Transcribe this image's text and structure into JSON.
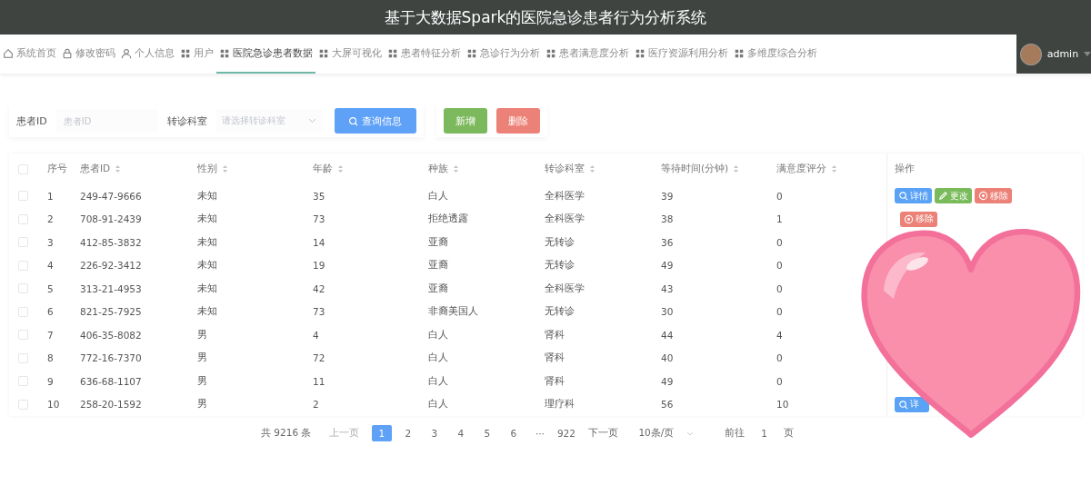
{
  "window": {
    "title": "基于大数据Spark的医院急诊患者行为分析系统"
  },
  "nav": {
    "items": [
      {
        "label": "系统首页",
        "kind": "home",
        "selected": false
      },
      {
        "label": "修改密码",
        "kind": "lock",
        "selected": false
      },
      {
        "label": "个人信息",
        "kind": "person",
        "selected": false
      },
      {
        "label": "用户",
        "kind": "grid",
        "selected": false
      },
      {
        "label": "医院急诊患者数据",
        "kind": "grid",
        "selected": true
      },
      {
        "label": "大屏可视化",
        "kind": "grid",
        "selected": false
      },
      {
        "label": "患者特征分析",
        "kind": "grid",
        "selected": false
      },
      {
        "label": "急诊行为分析",
        "kind": "grid",
        "selected": false
      },
      {
        "label": "患者满意度分析",
        "kind": "grid",
        "selected": false
      },
      {
        "label": "医疗资源利用分析",
        "kind": "grid",
        "selected": false
      },
      {
        "label": "多维度综合分析",
        "kind": "grid",
        "selected": false
      }
    ],
    "user": "admin"
  },
  "search": {
    "fields": [
      {
        "label": "患者ID",
        "placeholder": "患者ID",
        "kind": "input"
      },
      {
        "label": "转诊科室",
        "placeholder": "请选择转诊科室",
        "kind": "select"
      }
    ],
    "query_button": "查询信息"
  },
  "toolbar": [
    {
      "label": "新增",
      "kind": "add"
    },
    {
      "label": "删除",
      "kind": "delete"
    }
  ],
  "table": {
    "select_all": {
      "checked": false
    },
    "columns": [
      {
        "label": "序号",
        "sortable": false
      },
      {
        "label": "患者ID",
        "sortable": true
      },
      {
        "label": "性别",
        "sortable": true
      },
      {
        "label": "年龄",
        "sortable": true
      },
      {
        "label": "种族",
        "sortable": true
      },
      {
        "label": "转诊科室",
        "sortable": true
      },
      {
        "label": "等待时间(分钟)",
        "sortable": true
      },
      {
        "label": "满意度评分",
        "sortable": true
      },
      {
        "label": "操作",
        "sortable": false
      }
    ],
    "rows": [
      {
        "checked": false,
        "cells": [
          "1",
          "249-47-9666",
          "未知",
          "35",
          "白人",
          "全科医学",
          "39",
          "0"
        ],
        "actions": [
          {
            "kind": "detail",
            "label": "详情"
          },
          {
            "kind": "edit",
            "label": "更改"
          },
          {
            "kind": "remove",
            "label": "移除"
          }
        ]
      },
      {
        "checked": false,
        "cells": [
          "2",
          "708-91-2439",
          "未知",
          "73",
          "拒绝透露",
          "全科医学",
          "38",
          "1"
        ],
        "actions": [
          {
            "kind": "remove",
            "label": "移除"
          }
        ]
      },
      {
        "checked": false,
        "cells": [
          "3",
          "412-85-3832",
          "未知",
          "14",
          "亚裔",
          "无转诊",
          "36",
          "0"
        ],
        "actions": []
      },
      {
        "checked": false,
        "cells": [
          "4",
          "226-92-3412",
          "未知",
          "19",
          "亚裔",
          "无转诊",
          "49",
          "0"
        ],
        "actions": []
      },
      {
        "checked": false,
        "cells": [
          "5",
          "313-21-4953",
          "未知",
          "42",
          "亚裔",
          "全科医学",
          "43",
          "0"
        ],
        "actions": []
      },
      {
        "checked": false,
        "cells": [
          "6",
          "821-25-7925",
          "未知",
          "73",
          "非裔美国人",
          "无转诊",
          "30",
          "0"
        ],
        "actions": []
      },
      {
        "checked": false,
        "cells": [
          "7",
          "406-35-8082",
          "男",
          "4",
          "白人",
          "肾科",
          "44",
          "4"
        ],
        "actions": []
      },
      {
        "checked": false,
        "cells": [
          "8",
          "772-16-7370",
          "男",
          "72",
          "白人",
          "肾科",
          "40",
          "0"
        ],
        "actions": []
      },
      {
        "checked": false,
        "cells": [
          "9",
          "636-68-1107",
          "男",
          "11",
          "白人",
          "肾科",
          "49",
          "0"
        ],
        "actions": []
      },
      {
        "checked": false,
        "cells": [
          "10",
          "258-20-1592",
          "男",
          "2",
          "白人",
          "理疗科",
          "56",
          "10"
        ],
        "actions": [
          {
            "kind": "detail",
            "label": "详"
          }
        ]
      }
    ]
  },
  "pagination": {
    "total": "共 9216 条",
    "prev": "上一页",
    "pages": [
      {
        "label": "1",
        "selected": true
      },
      {
        "label": "2",
        "selected": false
      },
      {
        "label": "3",
        "selected": false
      },
      {
        "label": "4",
        "selected": false
      },
      {
        "label": "5",
        "selected": false
      },
      {
        "label": "6",
        "selected": false
      },
      {
        "label": "···",
        "selected": false
      },
      {
        "label": "922",
        "selected": false
      }
    ],
    "next": "下一页",
    "page_size": "10条/页",
    "goto": "前往",
    "goto_value": "1",
    "goto_suffix": "页"
  },
  "sticker": {
    "kind": "heart"
  }
}
